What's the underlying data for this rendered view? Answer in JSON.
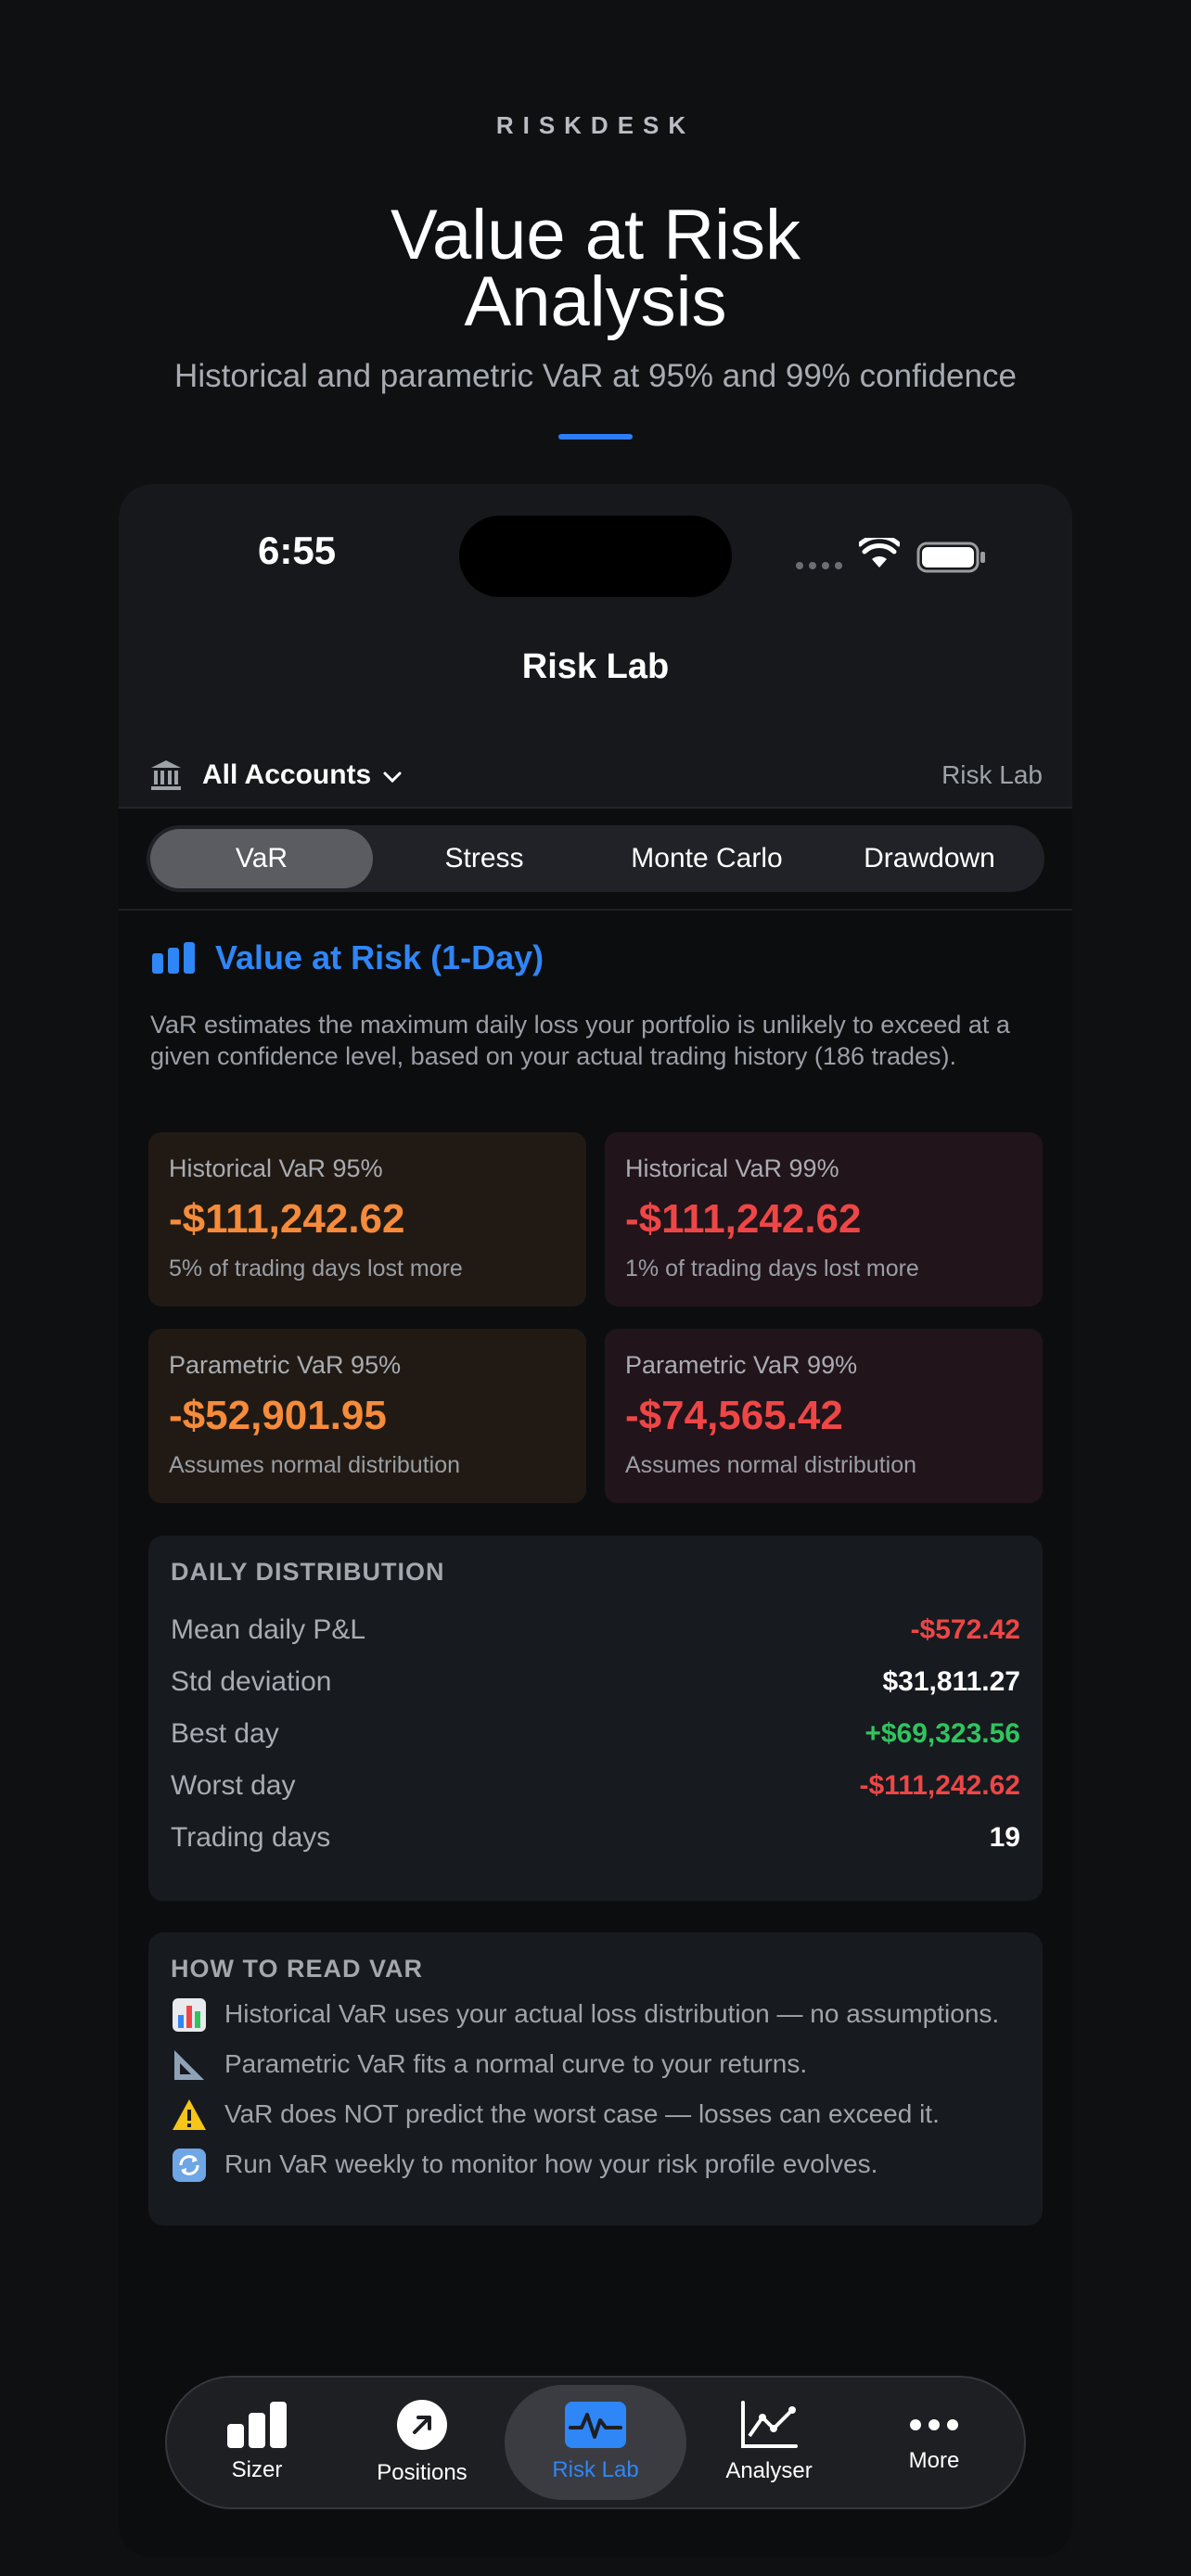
{
  "hero": {
    "brand": "RISKDESK",
    "title_line1": "Value at Risk",
    "title_line2": "Analysis",
    "subtitle": "Historical and parametric VaR at 95% and 99% confidence",
    "accent": "#2f7cf6"
  },
  "status_bar": {
    "time": "6:55"
  },
  "nav": {
    "title": "Risk Lab"
  },
  "account_bar": {
    "label": "All Accounts",
    "right_label": "Risk Lab"
  },
  "segments": [
    {
      "label": "VaR",
      "active": true
    },
    {
      "label": "Stress",
      "active": false
    },
    {
      "label": "Monte Carlo",
      "active": false
    },
    {
      "label": "Drawdown",
      "active": false
    }
  ],
  "section": {
    "title": "Value at Risk (1-Day)",
    "description": "VaR estimates the maximum daily loss your portfolio is unlikely to exceed at a given confidence level, based on your actual trading history (186 trades)."
  },
  "cards": [
    {
      "label": "Historical VaR 95%",
      "value": "-$111,242.62",
      "note": "5% of trading days lost more",
      "tone": "#f58b3b"
    },
    {
      "label": "Historical VaR 99%",
      "value": "-$111,242.62",
      "note": "1% of trading days lost more",
      "tone": "#ee4646"
    },
    {
      "label": "Parametric VaR 95%",
      "value": "-$52,901.95",
      "note": "Assumes normal distribution",
      "tone": "#f58b3b"
    },
    {
      "label": "Parametric VaR 99%",
      "value": "-$74,565.42",
      "note": "Assumes normal distribution",
      "tone": "#ee4646"
    }
  ],
  "distribution": {
    "title": "DAILY DISTRIBUTION",
    "rows": [
      {
        "key": "Mean daily P&L",
        "value": "-$572.42"
      },
      {
        "key": "Std deviation",
        "value": "$31,811.27"
      },
      {
        "key": "Best day",
        "value": "+$69,323.56"
      },
      {
        "key": "Worst day",
        "value": "-$111,242.62"
      },
      {
        "key": "Trading days",
        "value": "19"
      }
    ]
  },
  "howto": {
    "title": "HOW TO READ VAR",
    "tips": [
      {
        "icon": "bar-chart-icon",
        "text": "Historical VaR uses your actual loss distribution — no assumptions."
      },
      {
        "icon": "triangle-ruler-icon",
        "text": "Parametric VaR fits a normal curve to your returns."
      },
      {
        "icon": "warning-icon",
        "text": "VaR does NOT predict the worst case — losses can exceed it."
      },
      {
        "icon": "refresh-icon",
        "text": "Run VaR weekly to monitor how your risk profile evolves."
      }
    ]
  },
  "tabbar": [
    {
      "label": "Sizer",
      "icon": "bars-icon",
      "active": false
    },
    {
      "label": "Positions",
      "icon": "arrow-up-right-icon",
      "active": false
    },
    {
      "label": "Risk Lab",
      "icon": "waveform-icon",
      "active": true
    },
    {
      "label": "Analyser",
      "icon": "line-chart-icon",
      "active": false
    },
    {
      "label": "More",
      "icon": "more-icon",
      "active": false
    }
  ]
}
